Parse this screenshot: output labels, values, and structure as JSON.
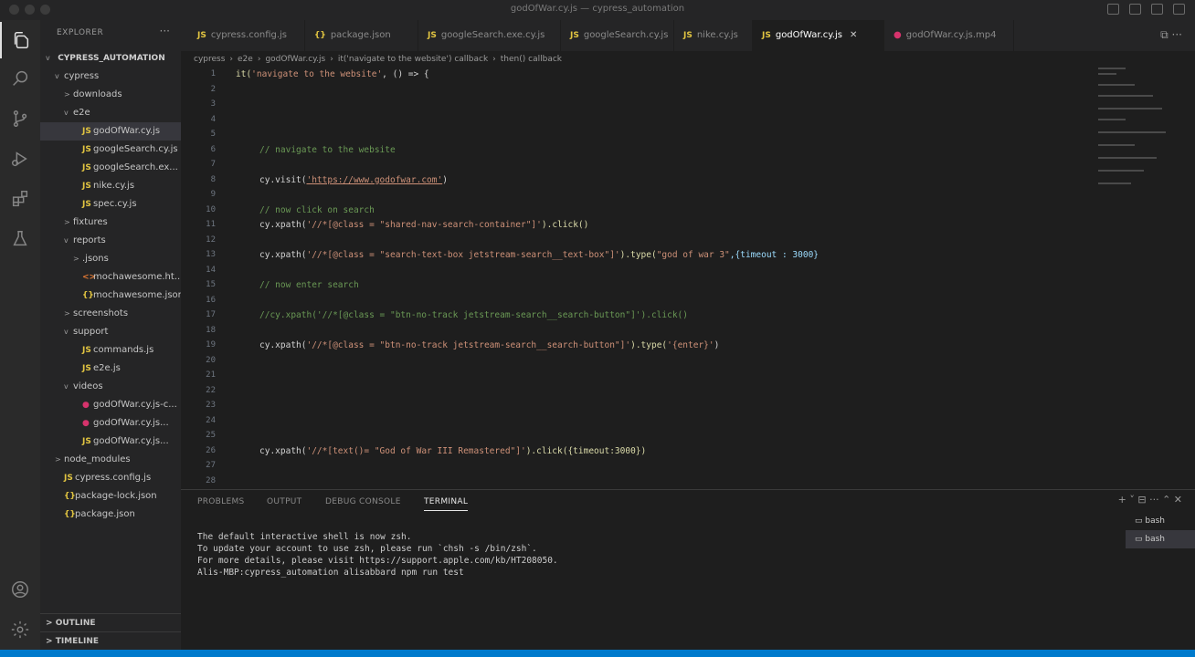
{
  "window": {
    "title": "godOfWar.cy.js — cypress_automation"
  },
  "explorer": {
    "header": "EXPLORER",
    "root": "CYPRESS_AUTOMATION",
    "tree": [
      {
        "label": "cypress",
        "indent": 1,
        "chev": "v",
        "icon": ""
      },
      {
        "label": "downloads",
        "indent": 2,
        "chev": ">",
        "icon": ""
      },
      {
        "label": "e2e",
        "indent": 2,
        "chev": "v",
        "icon": ""
      },
      {
        "label": "godOfWar.cy.js",
        "indent": 3,
        "chev": "",
        "icon": "JS",
        "selected": true
      },
      {
        "label": "googleSearch.cy.js",
        "indent": 3,
        "chev": "",
        "icon": "JS"
      },
      {
        "label": "googleSearch.ex...",
        "indent": 3,
        "chev": "",
        "icon": "JS"
      },
      {
        "label": "nike.cy.js",
        "indent": 3,
        "chev": "",
        "icon": "JS"
      },
      {
        "label": "spec.cy.js",
        "indent": 3,
        "chev": "",
        "icon": "JS"
      },
      {
        "label": "fixtures",
        "indent": 2,
        "chev": ">",
        "icon": ""
      },
      {
        "label": "reports",
        "indent": 2,
        "chev": "v",
        "icon": ""
      },
      {
        "label": ".jsons",
        "indent": 3,
        "chev": ">",
        "icon": ""
      },
      {
        "label": "mochawesome.ht...",
        "indent": 3,
        "chev": "",
        "icon": "<>"
      },
      {
        "label": "mochawesome.json",
        "indent": 3,
        "chev": "",
        "icon": "{}"
      },
      {
        "label": "screenshots",
        "indent": 2,
        "chev": ">",
        "icon": ""
      },
      {
        "label": "support",
        "indent": 2,
        "chev": "v",
        "icon": ""
      },
      {
        "label": "commands.js",
        "indent": 3,
        "chev": "",
        "icon": "JS"
      },
      {
        "label": "e2e.js",
        "indent": 3,
        "chev": "",
        "icon": "JS"
      },
      {
        "label": "videos",
        "indent": 2,
        "chev": "v",
        "icon": ""
      },
      {
        "label": "godOfWar.cy.js-c...",
        "indent": 3,
        "chev": "",
        "icon": "●"
      },
      {
        "label": "godOfWar.cy.js...",
        "indent": 3,
        "chev": "",
        "icon": "●"
      },
      {
        "label": "godOfWar.cy.js...",
        "indent": 3,
        "chev": "",
        "icon": "JS"
      },
      {
        "label": "node_modules",
        "indent": 1,
        "chev": ">",
        "icon": ""
      },
      {
        "label": "cypress.config.js",
        "indent": 1,
        "chev": "",
        "icon": "JS"
      },
      {
        "label": "package-lock.json",
        "indent": 1,
        "chev": "",
        "icon": "{}"
      },
      {
        "label": "package.json",
        "indent": 1,
        "chev": "",
        "icon": "{}"
      }
    ],
    "outline": "OUTLINE",
    "timeline": "TIMELINE"
  },
  "tabs": [
    {
      "label": "cypress.config.js",
      "icon": "JS",
      "active": false
    },
    {
      "label": "package.json",
      "icon": "{}",
      "active": false
    },
    {
      "label": "googleSearch.exe.cy.js",
      "icon": "JS",
      "active": false
    },
    {
      "label": "googleSearch.cy.js",
      "icon": "JS",
      "active": false
    },
    {
      "label": "nike.cy.js",
      "icon": "JS",
      "active": false
    },
    {
      "label": "godOfWar.cy.js",
      "icon": "JS",
      "active": true
    },
    {
      "label": "godOfWar.cy.js.mp4",
      "icon": "●",
      "active": false
    }
  ],
  "breadcrumb": [
    "cypress",
    "e2e",
    "godOfWar.cy.js",
    "it('navigate to the website') callback",
    "then() callback"
  ],
  "editor": {
    "lines": [
      {
        "n": "1",
        "indent": 0,
        "parts": [
          {
            "t": "it(",
            "c": "c-fn"
          },
          {
            "t": "'navigate to the website'",
            "c": "c-str"
          },
          {
            "t": ", () => {",
            "c": "c-plain"
          }
        ]
      },
      {
        "n": "2",
        "indent": 0,
        "parts": []
      },
      {
        "n": "3",
        "indent": 0,
        "parts": []
      },
      {
        "n": "4",
        "indent": 0,
        "parts": []
      },
      {
        "n": "5",
        "indent": 0,
        "parts": []
      },
      {
        "n": "6",
        "indent": 1,
        "parts": [
          {
            "t": "// navigate to the website",
            "c": "c-comment"
          }
        ]
      },
      {
        "n": "7",
        "indent": 0,
        "parts": []
      },
      {
        "n": "8",
        "indent": 1,
        "parts": [
          {
            "t": "cy.visit(",
            "c": "c-plain"
          },
          {
            "t": "'https://www.godofwar.com'",
            "c": "c-url"
          },
          {
            "t": ")",
            "c": "c-plain"
          }
        ]
      },
      {
        "n": "9",
        "indent": 0,
        "parts": []
      },
      {
        "n": "10",
        "indent": 1,
        "parts": [
          {
            "t": "// now click on search",
            "c": "c-comment"
          }
        ]
      },
      {
        "n": "11",
        "indent": 1,
        "parts": [
          {
            "t": "cy.xpath(",
            "c": "c-plain"
          },
          {
            "t": "'//*[@class = \"shared-nav-search-container\"]'",
            "c": "c-str"
          },
          {
            "t": ").click()",
            "c": "c-fn"
          }
        ]
      },
      {
        "n": "12",
        "indent": 0,
        "parts": []
      },
      {
        "n": "13",
        "indent": 1,
        "parts": [
          {
            "t": "cy.xpath(",
            "c": "c-plain"
          },
          {
            "t": "'//*[@class = \"search-text-box jetstream-search__text-box\"]'",
            "c": "c-str"
          },
          {
            "t": ").type(",
            "c": "c-fn"
          },
          {
            "t": "\"god of war 3\"",
            "c": "c-str"
          },
          {
            "t": ",{timeout : 3000}",
            "c": "c-var"
          }
        ]
      },
      {
        "n": "14",
        "indent": 0,
        "parts": []
      },
      {
        "n": "15",
        "indent": 1,
        "parts": [
          {
            "t": "// now enter search",
            "c": "c-comment"
          }
        ]
      },
      {
        "n": "16",
        "indent": 0,
        "parts": []
      },
      {
        "n": "17",
        "indent": 1,
        "parts": [
          {
            "t": "//cy.xpath('//*[@class = \"btn-no-track jetstream-search__search-button\"]').click()",
            "c": "c-comment"
          }
        ]
      },
      {
        "n": "18",
        "indent": 0,
        "parts": []
      },
      {
        "n": "19",
        "indent": 1,
        "parts": [
          {
            "t": "cy.xpath(",
            "c": "c-plain"
          },
          {
            "t": "'//*[@class = \"btn-no-track jetstream-search__search-button\"]'",
            "c": "c-str"
          },
          {
            "t": ").type(",
            "c": "c-fn"
          },
          {
            "t": "'{enter}'",
            "c": "c-str"
          },
          {
            "t": ")",
            "c": "c-plain"
          }
        ]
      },
      {
        "n": "20",
        "indent": 0,
        "parts": []
      },
      {
        "n": "21",
        "indent": 0,
        "parts": []
      },
      {
        "n": "22",
        "indent": 0,
        "parts": []
      },
      {
        "n": "23",
        "indent": 0,
        "parts": []
      },
      {
        "n": "24",
        "indent": 0,
        "parts": []
      },
      {
        "n": "25",
        "indent": 0,
        "parts": []
      },
      {
        "n": "26",
        "indent": 1,
        "parts": [
          {
            "t": "cy.xpath(",
            "c": "c-plain"
          },
          {
            "t": "'//*[text()= \"God of War III Remastered\"]'",
            "c": "c-str"
          },
          {
            "t": ").click({timeout:3000})",
            "c": "c-fn"
          }
        ]
      },
      {
        "n": "27",
        "indent": 0,
        "parts": []
      },
      {
        "n": "28",
        "indent": 0,
        "parts": []
      }
    ]
  },
  "panel": {
    "tabs": [
      "PROBLEMS",
      "OUTPUT",
      "DEBUG CONSOLE",
      "TERMINAL"
    ],
    "active_tab": "TERMINAL",
    "terminal_lines": [
      "The default interactive shell is now zsh.",
      "To update your account to use zsh, please run `chsh -s /bin/zsh`.",
      "For more details, please visit https://support.apple.com/kb/HT208050.",
      "Alis-MBP:cypress_automation alisabbard npm run test"
    ],
    "shells": [
      {
        "label": "bash",
        "active": false
      },
      {
        "label": "bash",
        "active": true
      }
    ]
  },
  "colors": {
    "accent": "#007acc",
    "js_icon": "#e2c541",
    "video_icon": "#d6336c"
  }
}
